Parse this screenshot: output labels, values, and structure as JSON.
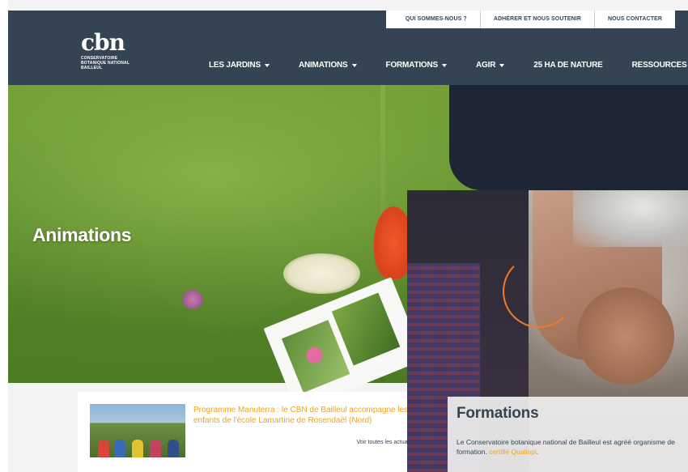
{
  "topbar": {
    "links": [
      "QUI SOMMES-NOUS ?",
      "ADHÉRER ET NOUS SOUTENIR",
      "NOUS CONTACTER"
    ]
  },
  "logo": {
    "mark": "cbn",
    "lines": [
      "CONSERVATOIRE",
      "BOTANIQUE NATIONAL",
      "BAILLEUL"
    ]
  },
  "nav": {
    "items": [
      {
        "label": "LES JARDINS"
      },
      {
        "label": "ANIMATIONS"
      },
      {
        "label": "FORMATIONS"
      },
      {
        "label": "AGIR"
      },
      {
        "label": "25 HA DE NATURE"
      },
      {
        "label": "RESSOURCES"
      }
    ]
  },
  "hero": {
    "title": "Animations"
  },
  "news": {
    "headline": "Programme Manuterra : le CBN de Bailleul accompagne les enfants de l'école Lamartine de Rosendaël (Nord)",
    "more_label": "Voir toutes les actualités"
  },
  "formations": {
    "title": "Formations",
    "text_line1": "Le Conservatoire botanique national de Bailleul est agréé organisme de",
    "text_line2_prefix": "formation. ",
    "text_line2_link": "certifié Qualiopi",
    "text_line2_suffix": "."
  },
  "colors": {
    "header_bg": "#354453",
    "accent": "#f0a318"
  }
}
